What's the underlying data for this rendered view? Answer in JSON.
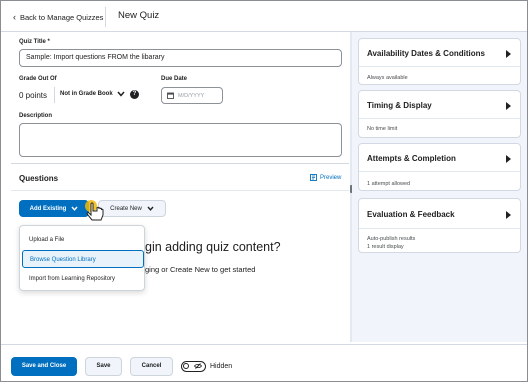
{
  "header": {
    "back_label": "Back to Manage Quizzes",
    "page_title": "New Quiz"
  },
  "form": {
    "quiz_title_label": "Quiz Title *",
    "quiz_title_value": "Sample: Import questions FROM the libarary",
    "grade_out_of_label": "Grade Out Of",
    "grade_points": "0 points",
    "gradebook_option": "Not in Grade Book",
    "due_date_label": "Due Date",
    "due_date_placeholder": "M/D/YYYY",
    "description_label": "Description"
  },
  "questions": {
    "title": "Questions",
    "preview_label": "Preview",
    "add_existing_label": "Add Existing",
    "create_new_label": "Create New",
    "dropdown_items": [
      {
        "label": "Upload a File"
      },
      {
        "label": "Browse Question Library"
      },
      {
        "label": "Import from Learning Repository"
      }
    ],
    "empty_heading": "gin adding quiz content?",
    "empty_subtext": "ging or Create New to get started"
  },
  "sidebar": {
    "cards": [
      {
        "title": "Availability Dates & Conditions",
        "lines": [
          "Always available"
        ]
      },
      {
        "title": "Timing & Display",
        "lines": [
          "No time limit"
        ]
      },
      {
        "title": "Attempts & Completion",
        "lines": [
          "1 attempt allowed"
        ]
      },
      {
        "title": "Evaluation & Feedback",
        "lines": [
          "Auto-publish results",
          "1 result display"
        ]
      }
    ]
  },
  "footer": {
    "save_close_label": "Save and Close",
    "save_label": "Save",
    "cancel_label": "Cancel",
    "visibility_label": "Hidden"
  },
  "colors": {
    "primary": "#006fbf",
    "sidebar_bg": "#f1f5fb",
    "border": "#d3d9e3"
  }
}
